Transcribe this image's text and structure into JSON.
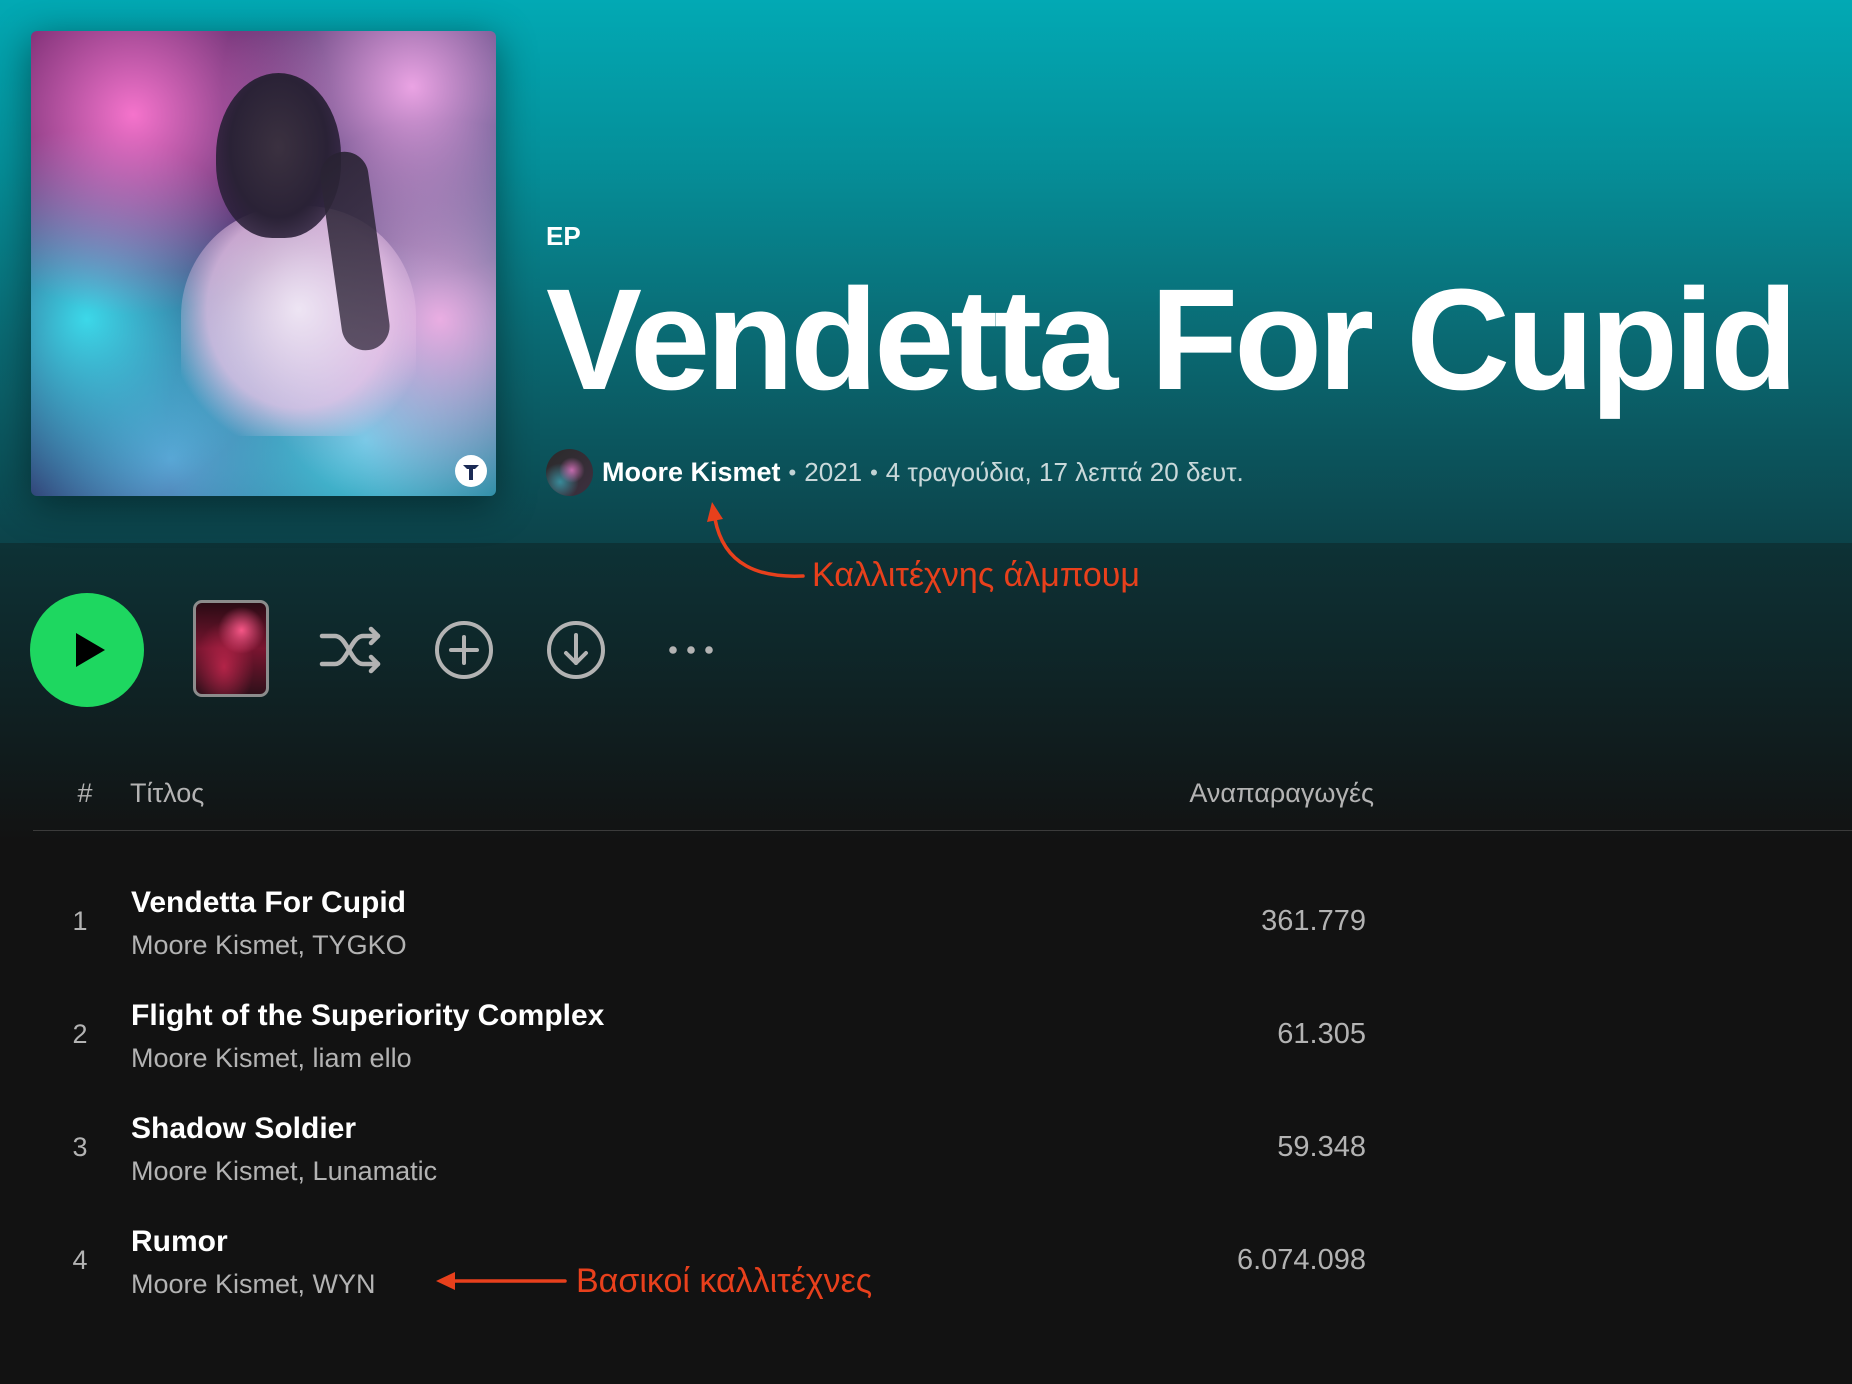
{
  "album": {
    "type_label": "EP",
    "title": "Vendetta For Cupid",
    "artist": "Moore Kismet",
    "separator": "•",
    "year": "2021",
    "summary": "4 τραγούδια, 17 λεπτά 20 δευτ.",
    "cover_icon": "album-cover-art",
    "avatar_icon": "artist-avatar"
  },
  "actions": {
    "play_icon": "play-icon",
    "queue_thumb_icon": "queue-thumbnail",
    "shuffle_icon": "shuffle-icon",
    "add_icon": "plus-circle-icon",
    "download_icon": "download-icon",
    "more_icon": "more-dots-icon"
  },
  "table": {
    "col_number": "#",
    "col_title": "Τίτλος",
    "col_plays": "Αναπαραγωγές"
  },
  "tracks": [
    {
      "number": "1",
      "title": "Vendetta For Cupid",
      "artists": "Moore Kismet, TYGKO",
      "plays": "361.779"
    },
    {
      "number": "2",
      "title": "Flight of the Superiority Complex",
      "artists": "Moore Kismet, liam ello",
      "plays": "61.305"
    },
    {
      "number": "3",
      "title": "Shadow Soldier",
      "artists": "Moore Kismet, Lunamatic",
      "plays": "59.348"
    },
    {
      "number": "4",
      "title": "Rumor",
      "artists": "Moore Kismet, WYN",
      "plays": "6.074.098"
    }
  ],
  "annotations": {
    "album_artist": "Καλλιτέχνης άλμπουμ",
    "main_artists": "Βασικοί καλλιτέχνες"
  },
  "colors": {
    "accent": "#1ed760",
    "annotation": "#e8401c",
    "header_top": "#02a9b4",
    "header_bottom": "#0c434a",
    "background": "#121212",
    "muted_text": "#b3b3b3"
  }
}
